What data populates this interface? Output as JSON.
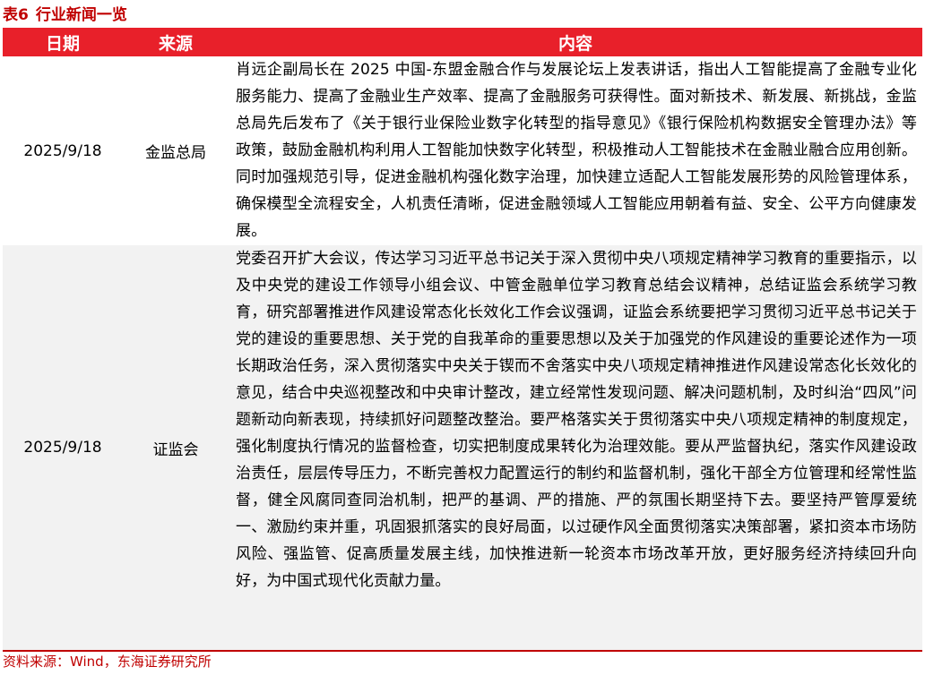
{
  "title": {
    "number": "表6",
    "text": "行业新闻一览"
  },
  "table": {
    "headers": {
      "date": "日期",
      "source": "来源",
      "content": "内容"
    },
    "rows": [
      {
        "date": "2025/9/18",
        "source": "金监总局",
        "content": "肖远企副局长在 2025 中国-东盟金融合作与发展论坛上发表讲话，指出人工智能提高了金融专业化服务能力、提高了金融业生产效率、提高了金融服务可获得性。面对新技术、新发展、新挑战，金监总局先后发布了《关于银行业保险业数字化转型的指导意见》《银行保险机构数据安全管理办法》等政策，鼓励金融机构利用人工智能加快数字化转型，积极推动人工智能技术在金融业融合应用创新。同时加强规范引导，促进金融机构强化数字治理，加快建立适配人工智能发展形势的风险管理体系，确保模型全流程安全，人机责任清晰，促进金融领域人工智能应用朝着有益、安全、公平方向健康发展。"
      },
      {
        "date": "2025/9/18",
        "source": "证监会",
        "content": "党委召开扩大会议，传达学习习近平总书记关于深入贯彻中央八项规定精神学习教育的重要指示，以及中央党的建设工作领导小组会议、中管金融单位学习教育总结会议精神，总结证监会系统学习教育，研究部署推进作风建设常态化长效化工作会议强调，证监会系统要把学习贯彻习近平总书记关于党的建设的重要思想、关于党的自我革命的重要思想以及关于加强党的作风建设的重要论述作为一项长期政治任务，深入贯彻落实中央关于锲而不舍落实中央八项规定精神推进作风建设常态化长效化的意见，结合中央巡视整改和中央审计整改，建立经常性发现问题、解决问题机制，及时纠治“四风”问题新动向新表现，持续抓好问题整改整治。要严格落实关于贯彻落实中央八项规定精神的制度规定，强化制度执行情况的监督检查，切实把制度成果转化为治理效能。要从严监督执纪，落实作风建设政治责任，层层传导压力，不断完善权力配置运行的制约和监督机制，强化干部全方位管理和经常性监督，健全风腐同查同治机制，把严的基调、严的措施、严的氛围长期坚持下去。要坚持严管厚爱统一、激励约束并重，巩固狠抓落实的良好局面，以过硬作风全面贯彻落实决策部署，紧扣资本市场防风险、强监管、促高质量发展主线，加快推进新一轮资本市场改革开放，更好服务经济持续回升向好，为中国式现代化贡献力量。"
      }
    ]
  },
  "source_note": "资料来源：Wind，东海证券研究所",
  "colors": {
    "accent": "#c00000",
    "header_background": "#e8202a",
    "alt_row_background": "#f2f2f2"
  }
}
